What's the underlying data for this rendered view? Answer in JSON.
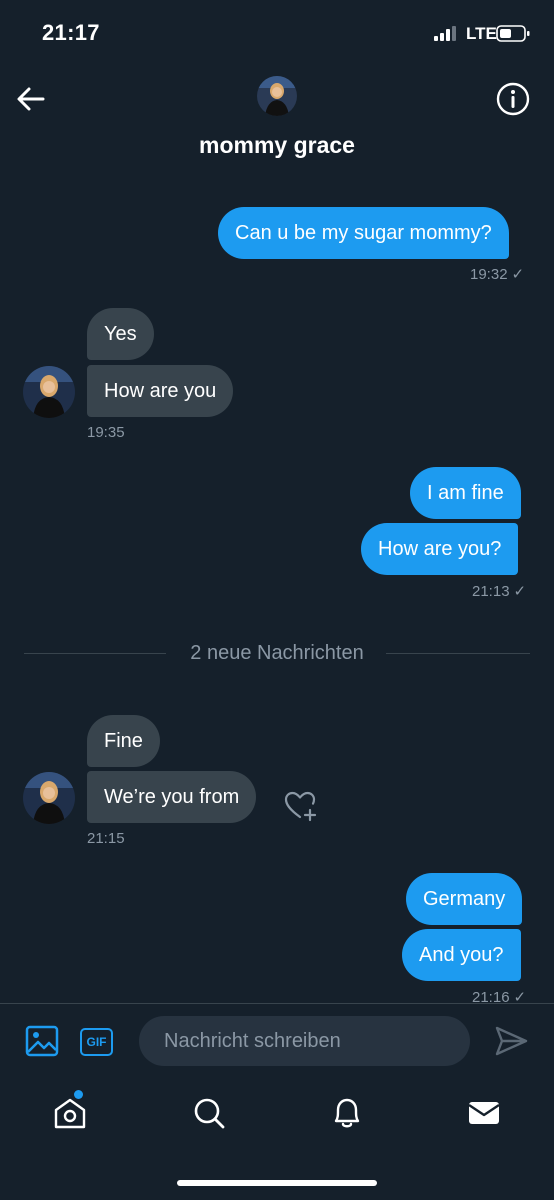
{
  "status_bar": {
    "time": "21:17",
    "network": "LTE"
  },
  "header": {
    "name": "mommy grace"
  },
  "messages": {
    "m1": {
      "text": "Can u be my sugar mommy?",
      "time": "19:32"
    },
    "m2": {
      "text": "Yes"
    },
    "m3": {
      "text": "How are you",
      "time": "19:35"
    },
    "m4": {
      "text": "I am fine"
    },
    "m5": {
      "text": "How are you?",
      "time": "21:13"
    },
    "m6": {
      "text": "Fine"
    },
    "m7": {
      "text": "We’re you from",
      "time": "21:15"
    },
    "m8": {
      "text": "Germany"
    },
    "m9": {
      "text": "And you?",
      "time": "21:16"
    }
  },
  "read_mark": "✓",
  "divider": {
    "label": "2 neue Nachrichten"
  },
  "composer": {
    "placeholder": "Nachricht schreiben",
    "gif_label": "GIF"
  },
  "tabs": [
    "home-icon",
    "search-icon",
    "bell-icon",
    "mail-icon"
  ],
  "colors": {
    "background": "#15202b",
    "accent": "#1d9bf0",
    "received_bubble": "#38444d",
    "muted_text": "#8b98a5"
  }
}
